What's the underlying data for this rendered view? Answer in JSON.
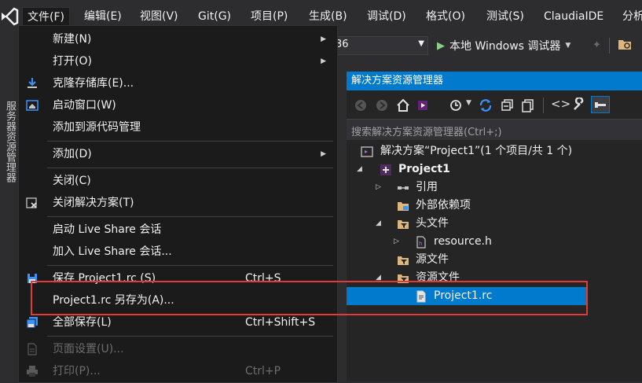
{
  "menubar": {
    "items": [
      {
        "name": "file",
        "label": "文件(F)"
      },
      {
        "name": "edit",
        "label": "编辑(E)"
      },
      {
        "name": "view",
        "label": "视图(V)"
      },
      {
        "name": "git",
        "label": "Git(G)"
      },
      {
        "name": "project",
        "label": "项目(P)"
      },
      {
        "name": "build",
        "label": "生成(B)"
      },
      {
        "name": "debug",
        "label": "调试(D)"
      },
      {
        "name": "format",
        "label": "格式(O)"
      },
      {
        "name": "test",
        "label": "测试(S)"
      },
      {
        "name": "claudia",
        "label": "ClaudiaIDE"
      },
      {
        "name": "analyze",
        "label": "分析"
      }
    ]
  },
  "toolbar": {
    "platform_value": "36",
    "run_label": "本地 Windows 调试器"
  },
  "left_strip": {
    "label": "服务器资源管理器"
  },
  "file_menu": {
    "items": [
      {
        "label": "新建(N)",
        "shortcut": "",
        "submenu": true,
        "disabled": false
      },
      {
        "label": "打开(O)",
        "shortcut": "",
        "submenu": true,
        "disabled": false
      },
      {
        "label": "克隆存储库(E)...",
        "shortcut": "",
        "submenu": false,
        "disabled": false
      },
      {
        "label": "启动窗口(W)",
        "shortcut": "",
        "submenu": false,
        "disabled": false
      },
      {
        "label": "添加到源代码管理",
        "shortcut": "",
        "submenu": false,
        "disabled": false
      },
      {
        "label": "添加(D)",
        "shortcut": "",
        "submenu": true,
        "disabled": false
      },
      {
        "label": "关闭(C)",
        "shortcut": "",
        "submenu": false,
        "disabled": false
      },
      {
        "label": "关闭解决方案(T)",
        "shortcut": "",
        "submenu": false,
        "disabled": false
      },
      {
        "label": "启动 Live Share 会话",
        "shortcut": "",
        "submenu": false,
        "disabled": false
      },
      {
        "label": "加入 Live Share 会话...",
        "shortcut": "",
        "submenu": false,
        "disabled": false
      },
      {
        "label": "保存 Project1.rc (S)",
        "shortcut": "Ctrl+S",
        "submenu": false,
        "disabled": false
      },
      {
        "label": "Project1.rc 另存为(A)...",
        "shortcut": "",
        "submenu": false,
        "disabled": false
      },
      {
        "label": "全部保存(L)",
        "shortcut": "Ctrl+Shift+S",
        "submenu": false,
        "disabled": false
      },
      {
        "label": "页面设置(U)...",
        "shortcut": "",
        "submenu": false,
        "disabled": true
      },
      {
        "label": "打印(P)...",
        "shortcut": "Ctrl+P",
        "submenu": false,
        "disabled": true
      }
    ]
  },
  "solution_explorer": {
    "title": "解决方案资源管理器",
    "search_placeholder": "搜索解决方案资源管理器(Ctrl+;)",
    "tree": [
      {
        "label": "解决方案“Project1”(1 个项目/共 1 个)"
      },
      {
        "label": "Project1"
      },
      {
        "label": "引用"
      },
      {
        "label": "外部依赖项"
      },
      {
        "label": "头文件"
      },
      {
        "label": "resource.h"
      },
      {
        "label": "源文件"
      },
      {
        "label": "资源文件"
      },
      {
        "label": "Project1.rc"
      }
    ]
  },
  "colors": {
    "accent": "#007acc",
    "background": "#2d2d30",
    "menu_bg": "#1b1b1c",
    "annotation": "#e53935"
  }
}
